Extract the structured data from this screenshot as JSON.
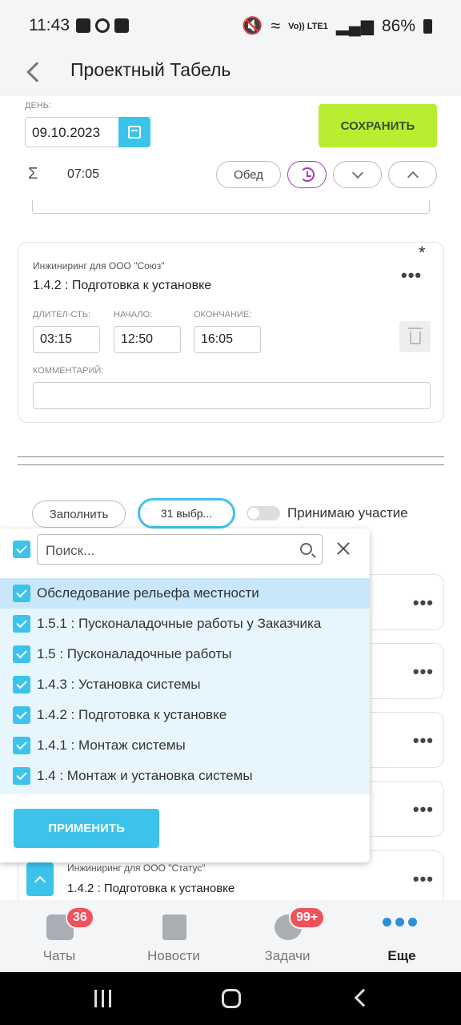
{
  "status_bar": {
    "time": "11:43",
    "lte": "Vo)) LTE1",
    "battery": "86%"
  },
  "header": {
    "title": "Проектный Табель"
  },
  "day_form": {
    "day_label": "ДЕНЬ:",
    "date_value": "09.10.2023",
    "save_label": "СОХРАНИТЬ",
    "sigma": "Σ",
    "total_time": "07:05",
    "lunch_label": "Обед"
  },
  "task_card": {
    "project": "Инжиниринг для ООО \"Союз\"",
    "task": "1.4.2 : Подготовка к установке",
    "star": "*",
    "menu": "•••",
    "duration_label": "ДЛИТЕЛ-СТЬ:",
    "duration_value": "03:15",
    "start_label": "НАЧАЛО:",
    "start_value": "12:50",
    "end_label": "ОКОНЧАНИЕ:",
    "end_value": "16:05",
    "comment_label": "КОММЕНТАРИЙ:",
    "comment_value": ""
  },
  "filter_bar": {
    "fill_label": "Заполнить",
    "selected_label": "31 выбр...",
    "participation_label": "Принимаю участие",
    "participation_on": false
  },
  "dropdown": {
    "search_placeholder": "Поиск...",
    "items": [
      {
        "label": "Обследование рельефа местности",
        "checked": true
      },
      {
        "label": "1.5.1 : Пусконаладочные работы у Заказчика",
        "checked": true
      },
      {
        "label": "1.5 : Пусконаладочные работы",
        "checked": true
      },
      {
        "label": "1.4.3 : Установка системы",
        "checked": true
      },
      {
        "label": "1.4.2 : Подготовка к установке",
        "checked": true
      },
      {
        "label": "1.4.1 : Монтаж системы",
        "checked": true
      },
      {
        "label": "1.4 : Монтаж и установка системы",
        "checked": true
      }
    ],
    "apply_label": "ПРИМЕНИТЬ"
  },
  "background_cards": {
    "menu": "•••"
  },
  "last_card": {
    "project": "Инжиниринг для ООО \"Статус\"",
    "task": "1.4.2 : Подготовка к установке",
    "menu": "•••"
  },
  "tabbar": {
    "tabs": [
      {
        "label": "Чаты",
        "badge": "36",
        "icon": "chat-icon"
      },
      {
        "label": "Новости",
        "badge": "",
        "icon": "news-icon"
      },
      {
        "label": "Задачи",
        "badge": "99+",
        "icon": "tasks-icon"
      },
      {
        "label": "Еще",
        "badge": "",
        "icon": "more-icon"
      }
    ]
  },
  "colors": {
    "accent": "#3cc3ec",
    "save": "#b8ee2f",
    "badge": "#f0525b",
    "history": "#a23bb5",
    "active_tab": "#2a8fd9"
  }
}
